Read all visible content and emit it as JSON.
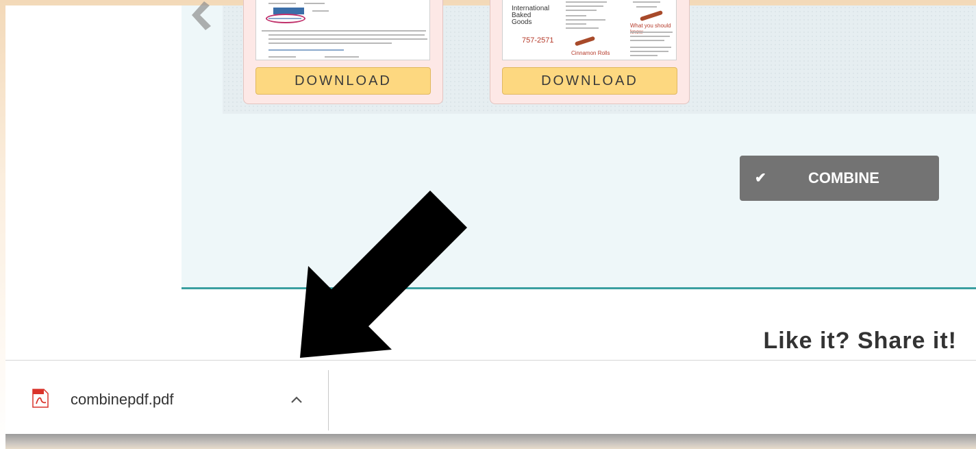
{
  "documents": [
    {
      "download_label": "DOWNLOAD"
    },
    {
      "download_label": "DOWNLOAD",
      "thumb_text": {
        "heading": "International\nBaked Goods",
        "phone": "757-2571",
        "link": "Cinnamon Rolls",
        "question": "What you should know"
      }
    }
  ],
  "combine_button": {
    "label": "COMBINE",
    "icon": "check-icon"
  },
  "share": {
    "title": "Like it? Share it!"
  },
  "download_bar": {
    "filename": "combinepdf.pdf",
    "file_icon": "pdf-file-icon",
    "toggle_icon": "chevron-up-icon"
  },
  "colors": {
    "accent_teal": "#3a9fa0",
    "download_button": "#fdd880",
    "combine_button": "#737373",
    "pdf_red": "#d9342b"
  }
}
